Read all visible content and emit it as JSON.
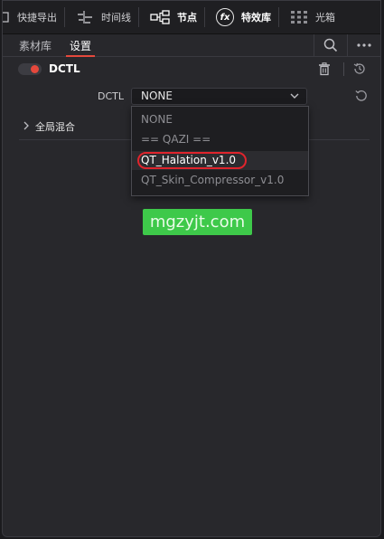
{
  "toolbar": {
    "items": [
      {
        "label": "快捷导出",
        "icon": "export-icon"
      },
      {
        "label": "时间线",
        "icon": "timeline-icon"
      },
      {
        "label": "节点",
        "icon": "nodes-icon"
      },
      {
        "label": "特效库",
        "icon": "fx-icon",
        "glyph": "fx"
      },
      {
        "label": "光箱",
        "icon": "lightbox-icon"
      }
    ],
    "active": "特效库"
  },
  "tabs": {
    "items": [
      {
        "label": "素材库"
      },
      {
        "label": "设置"
      }
    ],
    "active": "设置"
  },
  "dctl": {
    "title": "DCTL",
    "enabled": true,
    "field_label": "DCTL",
    "selected": "NONE",
    "options": [
      "NONE",
      "== QAZI ==",
      "QT_Halation_v1.0",
      "QT_Skin_Compressor_v1.0"
    ],
    "highlighted_option": "QT_Halation_v1.0"
  },
  "global_blend": {
    "label": "全局混合"
  },
  "watermark": {
    "text": "mgzyjt.com"
  },
  "colors": {
    "accent": "#e5483c",
    "annotation_ring": "#e0242c",
    "watermark_bg": "#3ec94a",
    "panel_bg": "#28282c",
    "toolbar_bg": "#1f1f22"
  }
}
